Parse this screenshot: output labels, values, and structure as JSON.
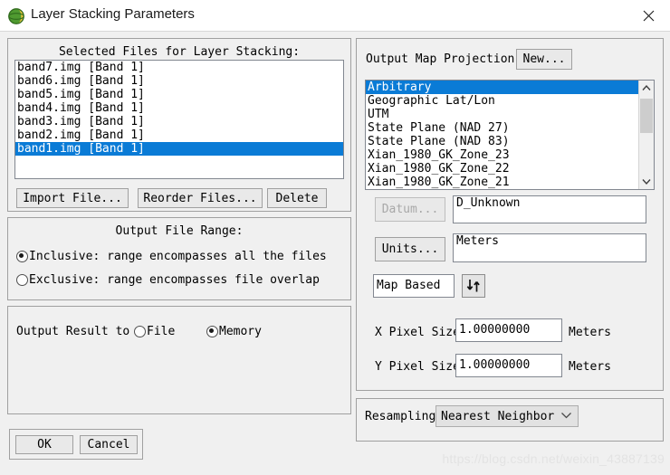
{
  "window": {
    "title": "Layer Stacking Parameters",
    "icon": "envi-globe-icon",
    "close_label": "✕"
  },
  "left_panel": {
    "files_group": {
      "heading": "Selected Files for Layer Stacking:",
      "files": [
        {
          "name": "band7.img [Band 1]",
          "selected": false
        },
        {
          "name": "band6.img [Band 1]",
          "selected": false
        },
        {
          "name": "band5.img [Band 1]",
          "selected": false
        },
        {
          "name": "band4.img [Band 1]",
          "selected": false
        },
        {
          "name": "band3.img [Band 1]",
          "selected": false
        },
        {
          "name": "band2.img [Band 1]",
          "selected": false
        },
        {
          "name": "band1.img [Band 1]",
          "selected": true
        }
      ],
      "buttons": {
        "import": "Import File...",
        "reorder": "Reorder Files...",
        "delete": "Delete"
      }
    },
    "output_file_range": {
      "heading": "Output File Range:",
      "options": [
        {
          "label": "Inclusive: range encompasses all the files",
          "selected": true
        },
        {
          "label": "Exclusive: range encompasses file overlap",
          "selected": false
        }
      ]
    },
    "output_result": {
      "label": "Output Result to",
      "options": [
        {
          "label": "File",
          "selected": false
        },
        {
          "label": "Memory",
          "selected": true
        }
      ]
    },
    "action_buttons": {
      "ok": "OK",
      "cancel": "Cancel"
    }
  },
  "right_panel": {
    "projection": {
      "label": "Output Map Projection",
      "new_button": "New...",
      "items": [
        {
          "label": "Arbitrary",
          "selected": true
        },
        {
          "label": "Geographic Lat/Lon",
          "selected": false
        },
        {
          "label": "UTM",
          "selected": false
        },
        {
          "label": "State Plane (NAD 27)",
          "selected": false
        },
        {
          "label": "State Plane (NAD 83)",
          "selected": false
        },
        {
          "label": "Xian_1980_GK_Zone_23",
          "selected": false
        },
        {
          "label": "Xian_1980_GK_Zone_22",
          "selected": false
        },
        {
          "label": "Xian_1980_GK_Zone_21",
          "selected": false
        }
      ]
    },
    "datum": {
      "button": "Datum...",
      "button_enabled": false,
      "value": "D_Unknown"
    },
    "units": {
      "button": "Units...",
      "button_enabled": true,
      "value": "Meters"
    },
    "map_based": {
      "value": "Map Based",
      "swap_icon": "down-up-arrows-icon"
    },
    "x_pixel_size": {
      "label": "X Pixel Size",
      "value": "1.00000000",
      "units": "Meters"
    },
    "y_pixel_size": {
      "label": "Y Pixel Size",
      "value": "1.00000000",
      "units": "Meters"
    },
    "resampling": {
      "label": "Resampling",
      "value": "Nearest Neighbor"
    }
  },
  "watermark": "https://blog.csdn.net/weixin_43887139",
  "colors": {
    "selection_blue": "#0a7bd6",
    "dialog_face": "#f0f0f0",
    "border": "#a0a0a0"
  }
}
